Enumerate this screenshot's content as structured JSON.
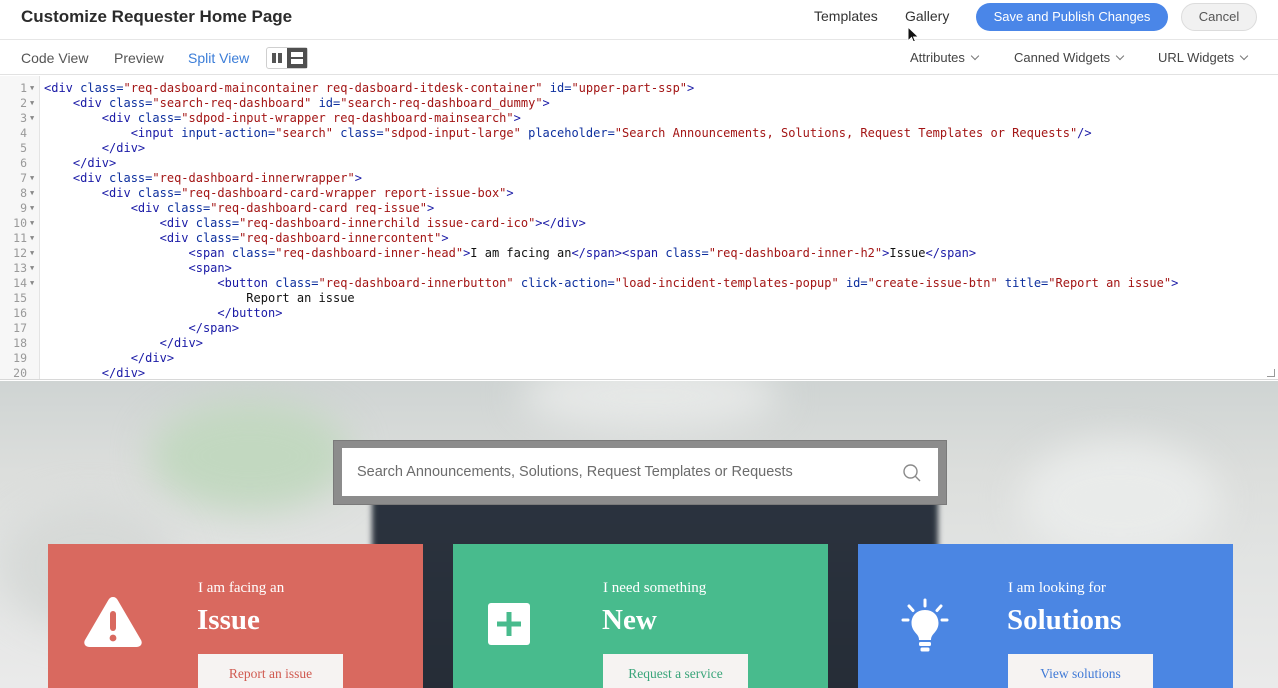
{
  "header": {
    "title": "Customize Requester Home Page",
    "templates_link": "Templates",
    "gallery_link": "Gallery",
    "publish_label": "Save and Publish Changes",
    "cancel_label": "Cancel"
  },
  "toolbar": {
    "tabs": [
      {
        "label": "Code View"
      },
      {
        "label": "Preview"
      },
      {
        "label": "Split View"
      }
    ],
    "dropdowns": [
      {
        "label": "Attributes"
      },
      {
        "label": "Canned Widgets"
      },
      {
        "label": "URL Widgets"
      }
    ]
  },
  "editor": {
    "lines": [
      {
        "n": "1",
        "fold": true
      },
      {
        "n": "2",
        "fold": true
      },
      {
        "n": "3",
        "fold": true
      },
      {
        "n": "4",
        "fold": false
      },
      {
        "n": "5",
        "fold": false
      },
      {
        "n": "6",
        "fold": false
      },
      {
        "n": "7",
        "fold": true
      },
      {
        "n": "8",
        "fold": true
      },
      {
        "n": "9",
        "fold": true
      },
      {
        "n": "10",
        "fold": true
      },
      {
        "n": "11",
        "fold": true
      },
      {
        "n": "12",
        "fold": true
      },
      {
        "n": "13",
        "fold": true
      },
      {
        "n": "14",
        "fold": true
      },
      {
        "n": "15",
        "fold": false
      },
      {
        "n": "16",
        "fold": false
      },
      {
        "n": "17",
        "fold": false
      },
      {
        "n": "18",
        "fold": false
      },
      {
        "n": "19",
        "fold": false
      },
      {
        "n": "20",
        "fold": false
      }
    ],
    "code": [
      [
        {
          "t": "tag",
          "s": "<div "
        },
        {
          "t": "attr",
          "s": "class="
        },
        {
          "t": "val",
          "s": "\"req-dasboard-maincontainer req-dasboard-itdesk-container\" "
        },
        {
          "t": "attr",
          "s": "id="
        },
        {
          "t": "val",
          "s": "\"upper-part-ssp\""
        },
        {
          "t": "tag",
          "s": ">"
        }
      ],
      [
        {
          "t": "txt",
          "s": "    "
        },
        {
          "t": "tag",
          "s": "<div "
        },
        {
          "t": "attr",
          "s": "class="
        },
        {
          "t": "val",
          "s": "\"search-req-dashboard\" "
        },
        {
          "t": "attr",
          "s": "id="
        },
        {
          "t": "val",
          "s": "\"search-req-dashboard_dummy\""
        },
        {
          "t": "tag",
          "s": ">"
        }
      ],
      [
        {
          "t": "txt",
          "s": "        "
        },
        {
          "t": "tag",
          "s": "<div "
        },
        {
          "t": "attr",
          "s": "class="
        },
        {
          "t": "val",
          "s": "\"sdpod-input-wrapper req-dashboard-mainsearch\""
        },
        {
          "t": "tag",
          "s": ">"
        }
      ],
      [
        {
          "t": "txt",
          "s": "            "
        },
        {
          "t": "tag",
          "s": "<input "
        },
        {
          "t": "attr",
          "s": "input-action="
        },
        {
          "t": "val",
          "s": "\"search\" "
        },
        {
          "t": "attr",
          "s": "class="
        },
        {
          "t": "val",
          "s": "\"sdpod-input-large\" "
        },
        {
          "t": "attr",
          "s": "placeholder="
        },
        {
          "t": "val",
          "s": "\"Search Announcements, Solutions, Request Templates or Requests\""
        },
        {
          "t": "tag",
          "s": "/>"
        }
      ],
      [
        {
          "t": "txt",
          "s": "        "
        },
        {
          "t": "tag",
          "s": "</div>"
        }
      ],
      [
        {
          "t": "txt",
          "s": "    "
        },
        {
          "t": "tag",
          "s": "</div>"
        }
      ],
      [
        {
          "t": "txt",
          "s": "    "
        },
        {
          "t": "tag",
          "s": "<div "
        },
        {
          "t": "attr",
          "s": "class="
        },
        {
          "t": "val",
          "s": "\"req-dashboard-innerwrapper\""
        },
        {
          "t": "tag",
          "s": ">"
        }
      ],
      [
        {
          "t": "txt",
          "s": "        "
        },
        {
          "t": "tag",
          "s": "<div "
        },
        {
          "t": "attr",
          "s": "class="
        },
        {
          "t": "val",
          "s": "\"req-dashboard-card-wrapper report-issue-box\""
        },
        {
          "t": "tag",
          "s": ">"
        }
      ],
      [
        {
          "t": "txt",
          "s": "            "
        },
        {
          "t": "tag",
          "s": "<div "
        },
        {
          "t": "attr",
          "s": "class="
        },
        {
          "t": "val",
          "s": "\"req-dashboard-card req-issue\""
        },
        {
          "t": "tag",
          "s": ">"
        }
      ],
      [
        {
          "t": "txt",
          "s": "                "
        },
        {
          "t": "tag",
          "s": "<div "
        },
        {
          "t": "attr",
          "s": "class="
        },
        {
          "t": "val",
          "s": "\"req-dashboard-innerchild issue-card-ico\""
        },
        {
          "t": "tag",
          "s": "></div>"
        }
      ],
      [
        {
          "t": "txt",
          "s": "                "
        },
        {
          "t": "tag",
          "s": "<div "
        },
        {
          "t": "attr",
          "s": "class="
        },
        {
          "t": "val",
          "s": "\"req-dashboard-innercontent\""
        },
        {
          "t": "tag",
          "s": ">"
        }
      ],
      [
        {
          "t": "txt",
          "s": "                    "
        },
        {
          "t": "tag",
          "s": "<span "
        },
        {
          "t": "attr",
          "s": "class="
        },
        {
          "t": "val",
          "s": "\"req-dashboard-inner-head\""
        },
        {
          "t": "tag",
          "s": ">"
        },
        {
          "t": "txt",
          "s": "I am facing an"
        },
        {
          "t": "tag",
          "s": "</span><span "
        },
        {
          "t": "attr",
          "s": "class="
        },
        {
          "t": "val",
          "s": "\"req-dashboard-inner-h2\""
        },
        {
          "t": "tag",
          "s": ">"
        },
        {
          "t": "txt",
          "s": "Issue"
        },
        {
          "t": "tag",
          "s": "</span>"
        }
      ],
      [
        {
          "t": "txt",
          "s": "                    "
        },
        {
          "t": "tag",
          "s": "<span>"
        }
      ],
      [
        {
          "t": "txt",
          "s": "                        "
        },
        {
          "t": "tag",
          "s": "<button "
        },
        {
          "t": "attr",
          "s": "class="
        },
        {
          "t": "val",
          "s": "\"req-dashboard-innerbutton\" "
        },
        {
          "t": "attr",
          "s": "click-action="
        },
        {
          "t": "val",
          "s": "\"load-incident-templates-popup\" "
        },
        {
          "t": "attr",
          "s": "id="
        },
        {
          "t": "val",
          "s": "\"create-issue-btn\" "
        },
        {
          "t": "attr",
          "s": "title="
        },
        {
          "t": "val",
          "s": "\"Report an issue\""
        },
        {
          "t": "tag",
          "s": ">"
        }
      ],
      [
        {
          "t": "txt",
          "s": "                            Report an issue"
        }
      ],
      [
        {
          "t": "txt",
          "s": "                        "
        },
        {
          "t": "tag",
          "s": "</button>"
        }
      ],
      [
        {
          "t": "txt",
          "s": "                    "
        },
        {
          "t": "tag",
          "s": "</span>"
        }
      ],
      [
        {
          "t": "txt",
          "s": "                "
        },
        {
          "t": "tag",
          "s": "</div>"
        }
      ],
      [
        {
          "t": "txt",
          "s": "            "
        },
        {
          "t": "tag",
          "s": "</div>"
        }
      ],
      [
        {
          "t": "txt",
          "s": "        "
        },
        {
          "t": "tag",
          "s": "</div>"
        }
      ]
    ]
  },
  "preview": {
    "search_placeholder": "Search Announcements, Solutions, Request Templates or Requests",
    "cards": [
      {
        "subtitle": "I am facing an",
        "heading": "Issue",
        "button": "Report an issue",
        "icon": "warning-icon",
        "color": "#d9695f"
      },
      {
        "subtitle": "I need something",
        "heading": "New",
        "button": "Request a service",
        "icon": "plus-icon",
        "color": "#48bb8d"
      },
      {
        "subtitle": "I am looking for",
        "heading": "Solutions",
        "button": "View solutions",
        "icon": "lightbulb-icon",
        "color": "#4b86e3"
      }
    ]
  },
  "colors": {
    "accent": "#4a86e8",
    "active_tab": "#3b7dd8"
  }
}
